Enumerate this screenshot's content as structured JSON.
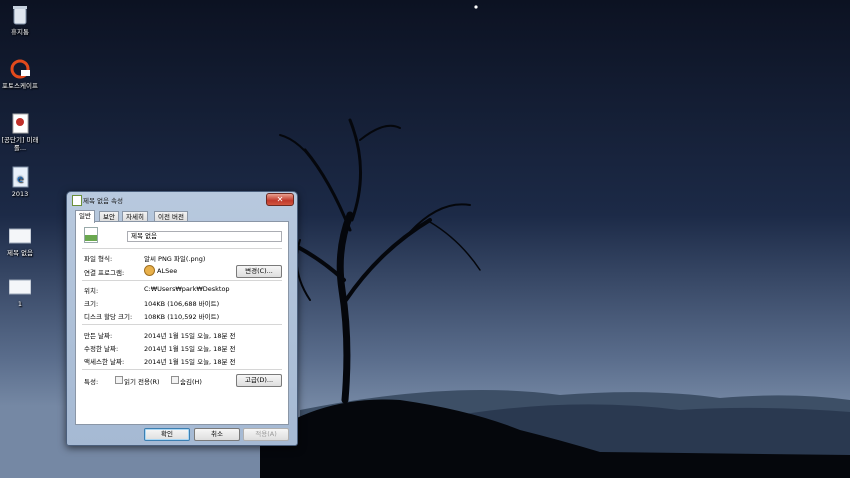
{
  "desktop": {
    "icons": [
      {
        "name": "recycle-bin",
        "label": "휴지통"
      },
      {
        "name": "photoscape",
        "label": "포토스케이프"
      },
      {
        "name": "shortcut-mirae",
        "label": "[공단기] 미래롤..."
      },
      {
        "name": "file-2013",
        "label": "2013"
      },
      {
        "name": "image-untitled",
        "label": "제목 없음"
      },
      {
        "name": "image-1",
        "label": "1"
      }
    ]
  },
  "dialog": {
    "title": "제목 없음 속성",
    "close_glyph": "✕",
    "tabs": [
      "일반",
      "보안",
      "자세히",
      "이전 버전"
    ],
    "file_name": "제목 없음",
    "rows": {
      "file_type_label": "파일 형식:",
      "file_type_value": "알씨 PNG 파일(.png)",
      "opens_with_label": "연결 프로그램:",
      "opens_with_value": "ALSee",
      "change_button": "변경(C)...",
      "location_label": "위치:",
      "location_value": "C:₩Users₩park₩Desktop",
      "size_label": "크기:",
      "size_value": "104KB (106,688 바이트)",
      "size_on_disk_label": "디스크 할당 크기:",
      "size_on_disk_value": "108KB (110,592 바이트)",
      "created_label": "만든 날짜:",
      "created_value": "2014년 1월 15일 오늘, 18분 전",
      "modified_label": "수정한 날짜:",
      "modified_value": "2014년 1월 15일 오늘, 18분 전",
      "accessed_label": "액세스한 날짜:",
      "accessed_value": "2014년 1월 15일 오늘, 18분 전",
      "attributes_label": "특성:",
      "readonly_label": "읽기 전용(R)",
      "hidden_label": "숨김(H)",
      "advanced_button": "고급(D)..."
    },
    "buttons": {
      "ok": "확인",
      "cancel": "취소",
      "apply": "적용(A)"
    }
  },
  "colors": {
    "accent": "#3c7fb1",
    "close": "#c0392b"
  }
}
